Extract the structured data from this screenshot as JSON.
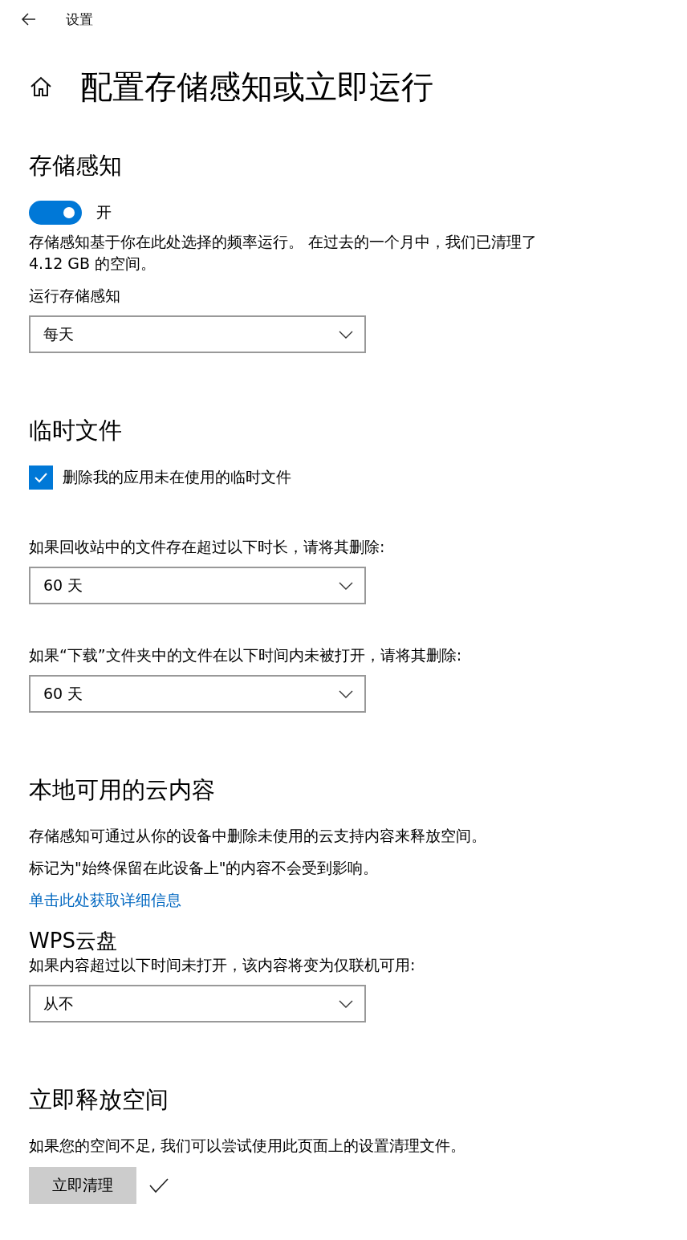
{
  "header": {
    "title": "设置"
  },
  "page_title": "配置存储感知或立即运行",
  "sections": [
    {
      "heading": "存储感知",
      "items": [
        {
          "kind": "toggle",
          "on": true,
          "label": "开"
        },
        {
          "kind": "text",
          "text": "存储感知基于你在此处选择的频率运行。 在过去的一个月中，我们已清理了 4.12 GB 的空间。"
        },
        {
          "kind": "label",
          "text": "运行存储感知"
        },
        {
          "kind": "dropdown",
          "value": "每天"
        }
      ]
    },
    {
      "heading": "临时文件",
      "items": [
        {
          "kind": "checkbox",
          "checked": true,
          "label": "删除我的应用未在使用的临时文件"
        },
        {
          "kind": "label",
          "text": "如果回收站中的文件存在超过以下时长，请将其删除:"
        },
        {
          "kind": "dropdown",
          "value": "60 天"
        },
        {
          "kind": "label",
          "text": "如果“下载”文件夹中的文件在以下时间内未被打开，请将其删除:"
        },
        {
          "kind": "dropdown",
          "value": "60 天"
        }
      ]
    },
    {
      "heading": "本地可用的云内容",
      "items": [
        {
          "kind": "text",
          "text": "存储感知可通过从你的设备中删除未使用的云支持内容来释放空间。"
        },
        {
          "kind": "text",
          "text": "标记为\"始终保留在此设备上\"的内容不会受到影响。"
        },
        {
          "kind": "link",
          "text": "单击此处获取详细信息"
        },
        {
          "kind": "subheading",
          "text": "WPS云盘"
        },
        {
          "kind": "label",
          "text": "如果内容超过以下时间未打开，该内容将变为仅联机可用:"
        },
        {
          "kind": "dropdown",
          "value": "从不"
        }
      ]
    },
    {
      "heading": "立即释放空间",
      "items": [
        {
          "kind": "text",
          "text": "如果您的空间不足, 我们可以尝试使用此页面上的设置清理文件。"
        },
        {
          "kind": "button",
          "label": "立即清理",
          "done": true
        }
      ]
    }
  ]
}
